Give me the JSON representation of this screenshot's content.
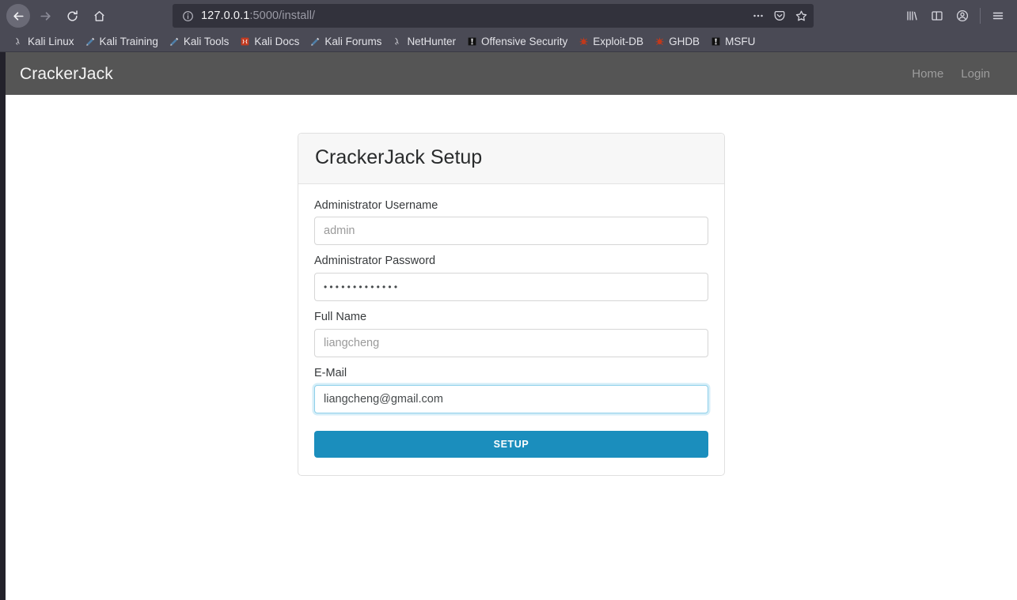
{
  "browser": {
    "nav": {
      "back": "back-arrow",
      "forward": "forward-arrow",
      "reload": "reload-icon",
      "home": "home-icon"
    },
    "urlbar": {
      "info_icon": "info-circle-icon",
      "host": "127.0.0.1",
      "path": ":5000/install/",
      "full_url": "127.0.0.1:5000/install/",
      "actions": [
        "page-actions-ellipsis-icon",
        "pocket-icon",
        "bookmark-star-icon"
      ]
    },
    "toolbar_right": [
      "library-icon",
      "sidebar-icon",
      "account-icon",
      "hamburger-menu-icon"
    ],
    "bookmarks": [
      {
        "label": "Kali Linux",
        "icon": "kali-dragon-icon"
      },
      {
        "label": "Kali Training",
        "icon": "kali-tool-icon"
      },
      {
        "label": "Kali Tools",
        "icon": "kali-tool-icon"
      },
      {
        "label": "Kali Docs",
        "icon": "kali-docs-book-icon"
      },
      {
        "label": "Kali Forums",
        "icon": "kali-tool-icon"
      },
      {
        "label": "NetHunter",
        "icon": "kali-dragon-icon"
      },
      {
        "label": "Offensive Security",
        "icon": "offsec-icon"
      },
      {
        "label": "Exploit-DB",
        "icon": "exploit-db-icon"
      },
      {
        "label": "GHDB",
        "icon": "exploit-db-icon"
      },
      {
        "label": "MSFU",
        "icon": "offsec-icon"
      }
    ]
  },
  "page": {
    "navbar": {
      "brand": "CrackerJack",
      "links": [
        {
          "label": "Home"
        },
        {
          "label": "Login"
        }
      ]
    },
    "card": {
      "title": "CrackerJack Setup",
      "fields": [
        {
          "label": "Administrator Username",
          "name": "username",
          "value": "",
          "placeholder": "admin",
          "type": "text",
          "focused": false
        },
        {
          "label": "Administrator Password",
          "name": "password",
          "value": "•••••••••••••",
          "placeholder": "",
          "type": "password",
          "focused": false
        },
        {
          "label": "Full Name",
          "name": "fullname",
          "value": "",
          "placeholder": "liangcheng",
          "type": "text",
          "focused": false
        },
        {
          "label": "E-Mail",
          "name": "email",
          "value": "liangcheng@gmail.com",
          "placeholder": "",
          "type": "email",
          "focused": true
        }
      ],
      "submit_label": "SETUP"
    }
  },
  "colors": {
    "chrome": "#4a4a55",
    "urlbar": "#32323c",
    "navbar": "#555555",
    "accent": "#1b8ebd",
    "focus_border": "#8fd0ea",
    "card_header": "#f7f7f7"
  }
}
